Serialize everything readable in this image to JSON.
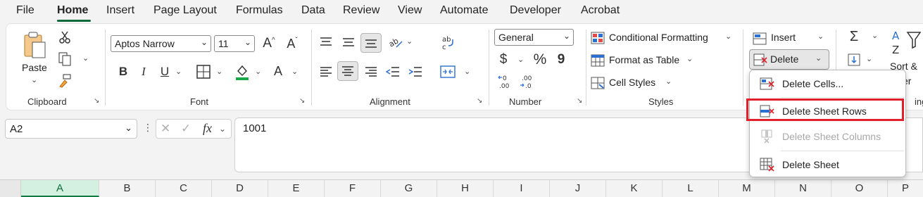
{
  "menu": {
    "items": [
      "File",
      "Home",
      "Insert",
      "Page Layout",
      "Formulas",
      "Data",
      "Review",
      "View",
      "Automate",
      "Developer",
      "Acrobat"
    ],
    "active": "Home"
  },
  "clipboard": {
    "paste_label": "Paste",
    "group_label": "Clipboard"
  },
  "font": {
    "family": "Aptos Narrow",
    "size": "11",
    "group_label": "Font",
    "bold": "B",
    "italic": "I",
    "underline": "U",
    "grow": "A",
    "shrink": "A",
    "color_a": "A"
  },
  "alignment": {
    "group_label": "Alignment"
  },
  "number": {
    "format": "General",
    "currency": "$",
    "percent": "%",
    "comma": "9",
    "inc_dec_top": "←0",
    "inc_dec_bottom": ".00",
    "dec_top": ".00",
    "dec_bottom": "→.0",
    "group_label": "Number"
  },
  "styles": {
    "conditional": "Conditional Formatting",
    "format_table": "Format as Table",
    "cell_styles": "Cell Styles",
    "group_label": "Styles"
  },
  "cells": {
    "insert": "Insert",
    "delete": "Delete"
  },
  "editing": {
    "sort_label": "Sort &",
    "filter_partial": "er",
    "group_partial": "ing"
  },
  "formula_bar": {
    "name_box": "A2",
    "fx": "fx",
    "value": "1001"
  },
  "columns": [
    "A",
    "B",
    "C",
    "D",
    "E",
    "F",
    "G",
    "H",
    "I",
    "J",
    "K",
    "L",
    "M",
    "N",
    "O",
    "P"
  ],
  "delete_menu": {
    "items": [
      {
        "label": "Delete Cells...",
        "disabled": false
      },
      {
        "label": "Delete Sheet Rows",
        "disabled": false
      },
      {
        "label": "Delete Sheet Columns",
        "disabled": true
      },
      {
        "label": "Delete Sheet",
        "disabled": false
      }
    ],
    "highlighted": "Delete Sheet Rows"
  },
  "colors": {
    "accent": "#107c41",
    "highlight_box": "#e0202a",
    "selected_col_bg": "#d3f0e0"
  }
}
